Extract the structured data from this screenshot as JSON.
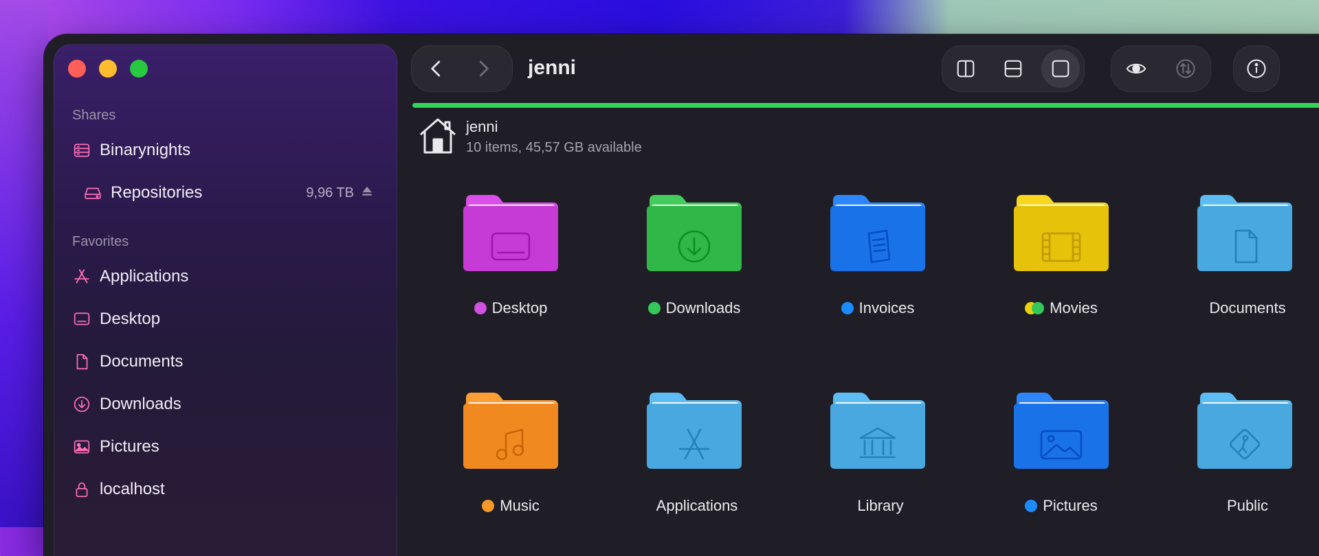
{
  "window": {
    "title": "jenni"
  },
  "sidebar": {
    "shares_title": "Shares",
    "favorites_title": "Favorites",
    "shares": [
      {
        "label": "Binarynights",
        "icon": "server-icon"
      },
      {
        "label": "Repositories",
        "icon": "drive-icon",
        "size": "9,96 TB"
      }
    ],
    "favorites": [
      {
        "label": "Applications",
        "icon": "applications-icon"
      },
      {
        "label": "Desktop",
        "icon": "desktop-icon"
      },
      {
        "label": "Documents",
        "icon": "document-icon"
      },
      {
        "label": "Downloads",
        "icon": "download-icon"
      },
      {
        "label": "Pictures",
        "icon": "pictures-icon"
      },
      {
        "label": "localhost",
        "icon": "lock-icon"
      }
    ]
  },
  "path": {
    "name": "jenni",
    "info": "10 items, 45,57 GB available"
  },
  "progress": {
    "value": 1.0,
    "color": "#32d45a"
  },
  "folders": [
    {
      "label": "Desktop",
      "color": "#c63ad6",
      "tags": [
        "#cf52e0"
      ],
      "icon": "desktop-glyph"
    },
    {
      "label": "Downloads",
      "color": "#2fb847",
      "tags": [
        "#34c85a"
      ],
      "icon": "download-glyph"
    },
    {
      "label": "Invoices",
      "color": "#1a72e8",
      "tags": [
        "#1a8cff"
      ],
      "icon": "invoice-glyph"
    },
    {
      "label": "Movies",
      "color": "#e6c20a",
      "tags": [
        "#e8d20c",
        "#34c85a"
      ],
      "icon": "film-glyph"
    },
    {
      "label": "Documents",
      "color": "#4aa8e0",
      "tags": [],
      "icon": "document-glyph"
    },
    {
      "label": "Music",
      "color": "#f08a20",
      "tags": [
        "#f59a2a"
      ],
      "icon": "music-glyph"
    },
    {
      "label": "Applications",
      "color": "#4aa8e0",
      "tags": [],
      "icon": "applications-glyph"
    },
    {
      "label": "Library",
      "color": "#4aa8e0",
      "tags": [],
      "icon": "library-glyph"
    },
    {
      "label": "Pictures",
      "color": "#1a72e8",
      "tags": [
        "#1a8cff"
      ],
      "icon": "pictures-glyph"
    },
    {
      "label": "Public",
      "color": "#4aa8e0",
      "tags": [],
      "icon": "public-glyph"
    }
  ]
}
